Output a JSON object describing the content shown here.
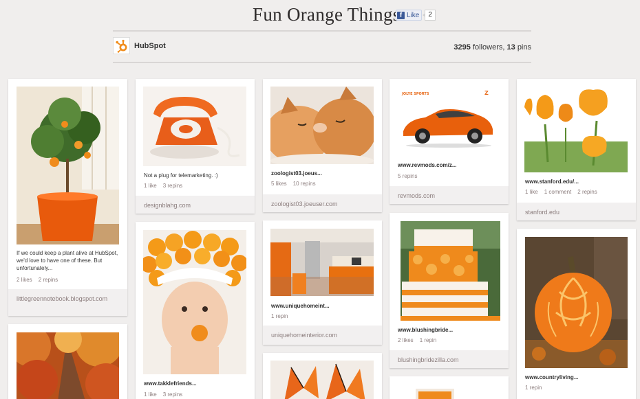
{
  "board": {
    "title": "Fun Orange Things",
    "like_label": "Like",
    "like_count": "2",
    "owner": "HubSpot",
    "followers": "3295",
    "followers_label": "followers,",
    "pins": "13",
    "pins_label": "pins"
  },
  "colors": {
    "accent": "#f08c1c",
    "fb_blue": "#3b5998",
    "bg": "#f0eeed"
  },
  "pins": [
    {
      "desc": "If we could keep a plant alive at HubSpot, we'd love to have one of these. But unfortunately...",
      "likes": "2 likes",
      "repins": "2 repins",
      "source": "littlegreennotebook.blogspot.com"
    },
    {
      "desc": "",
      "likes": "",
      "repins": "",
      "source": ""
    },
    {
      "desc": "Not a plug for telemarketing. :)",
      "likes": "1 like",
      "repins": "3 repins",
      "source": "designblahg.com"
    },
    {
      "desc": "www.takklefriends...",
      "likes": "1 like",
      "repins": "3 repins",
      "source": ""
    },
    {
      "desc": "zoologist03.joeus...",
      "likes": "5 likes",
      "repins": "10 repins",
      "source": "zoologist03.joeuser.com"
    },
    {
      "desc": "www.uniquehomeint...",
      "likes": "1 repin",
      "repins": "",
      "source": "uniquehomeinterior.com"
    },
    {
      "desc": "",
      "likes": "",
      "repins": "",
      "source": ""
    },
    {
      "desc": "www.revmods.com/z...",
      "likes": "5 repins",
      "repins": "",
      "source": "revmods.com"
    },
    {
      "desc": "www.blushingbride...",
      "likes": "2 likes",
      "repins": "1 repin",
      "source": "blushingbridezilla.com"
    },
    {
      "desc": "",
      "likes": "",
      "repins": "",
      "source": ""
    },
    {
      "desc": "www.stanford.edu/...",
      "likes": "1 like",
      "comments": "1 comment",
      "repins": "2 repins",
      "source": "stanford.edu"
    },
    {
      "desc": "www.countryliving...",
      "likes": "1 repin",
      "repins": "",
      "source": ""
    }
  ]
}
